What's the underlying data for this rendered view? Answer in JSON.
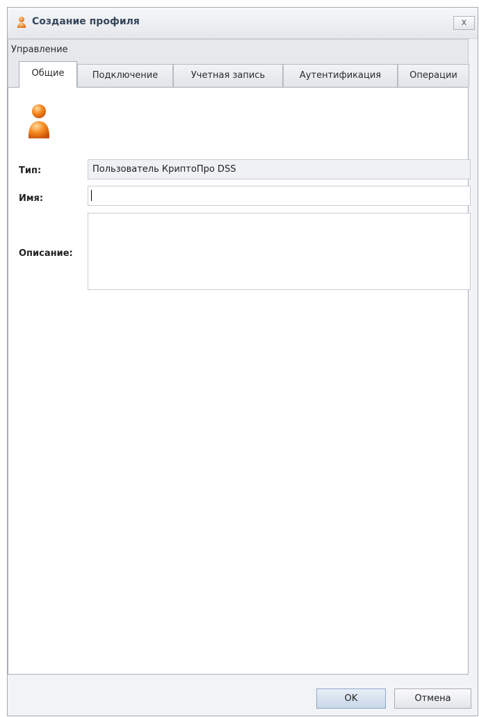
{
  "window": {
    "title": "Создание профиля",
    "close_label": "x"
  },
  "tab_group": {
    "label": "Управление"
  },
  "tabs": [
    {
      "label": "Общие",
      "active": true
    },
    {
      "label": "Подключение",
      "active": false
    },
    {
      "label": "Учетная запись",
      "active": false
    },
    {
      "label": "Аутентификация",
      "active": false
    },
    {
      "label": "Операции",
      "active": false
    }
  ],
  "form": {
    "type_label": "Тип:",
    "type_value": "Пользователь КриптоПро DSS",
    "name_label": "Имя:",
    "name_value": "",
    "description_label": "Описание:",
    "description_value": ""
  },
  "buttons": {
    "ok_label": "OK",
    "cancel_label": "Отмена"
  },
  "icons": {
    "title": "user-icon",
    "profile": "user-icon"
  },
  "colors": {
    "accent_orange": "#f07a10",
    "title_text": "#37465a"
  }
}
